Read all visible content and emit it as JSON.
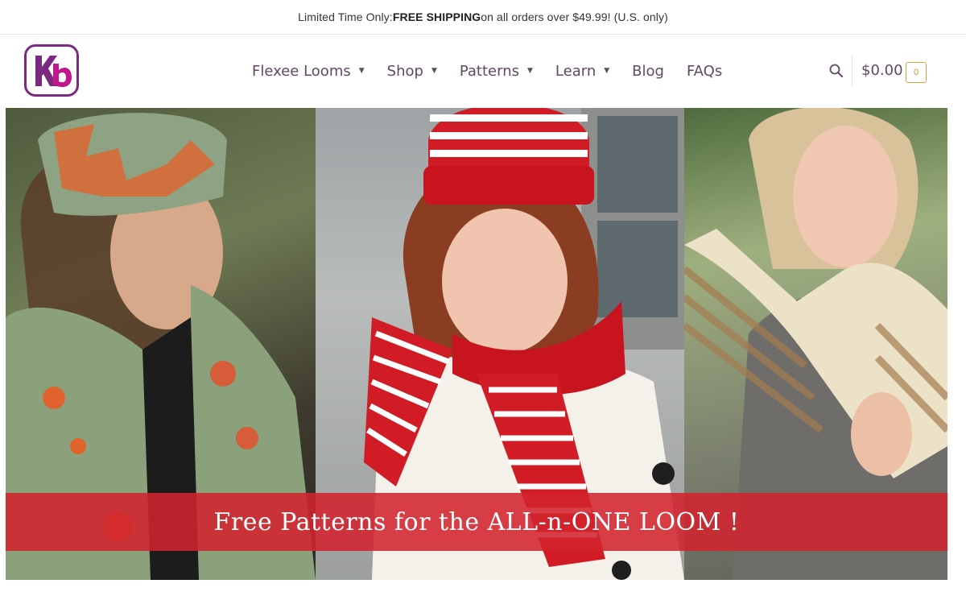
{
  "promo": {
    "prefix": "Limited Time Only: ",
    "highlight": "FREE SHIPPING",
    "suffix": " on all orders over $49.99! (U.S. only)"
  },
  "logo": {
    "text": "Kb",
    "color": "#7b2a80",
    "accent": "#c0188b"
  },
  "nav": {
    "items": [
      {
        "label": "Flexee Looms",
        "has_dropdown": true
      },
      {
        "label": "Shop",
        "has_dropdown": true
      },
      {
        "label": "Patterns",
        "has_dropdown": true
      },
      {
        "label": "Learn",
        "has_dropdown": true
      },
      {
        "label": "Blog",
        "has_dropdown": false
      },
      {
        "label": "FAQs",
        "has_dropdown": false
      }
    ],
    "caret": "▼"
  },
  "header": {
    "search_icon": "search-icon",
    "cart_total": "$0.00",
    "cart_count": "0",
    "accent": "#d4a43b"
  },
  "hero": {
    "banner_text": "Free Patterns  for the ALL-n-ONE LOOM !",
    "banner_color": "#d2232d"
  }
}
